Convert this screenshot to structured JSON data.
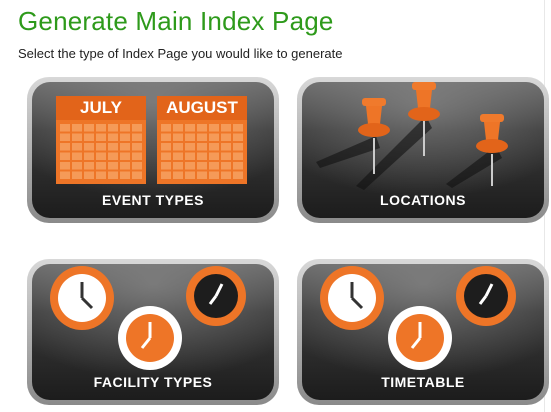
{
  "page": {
    "title": "Generate Main Index Page",
    "subtitle": "Select the type of Index Page you would like to generate"
  },
  "tiles": [
    {
      "id": "event",
      "label": "EVENT TYPES",
      "icon": "calendar-icon",
      "calendars": [
        {
          "month": "JULY"
        },
        {
          "month": "AUGUST"
        }
      ]
    },
    {
      "id": "location",
      "label": "LOCATIONS",
      "icon": "pushpin-icon"
    },
    {
      "id": "facility",
      "label": "FACILITY TYPES",
      "icon": "clock-icon"
    },
    {
      "id": "timetable",
      "label": "TIMETABLE",
      "icon": "clock-icon"
    }
  ],
  "colors": {
    "title": "#2e9a1b",
    "accent": "#ee7527",
    "tile_dark": "#2a2a2a",
    "tile_frame": "#9a9a9a"
  }
}
